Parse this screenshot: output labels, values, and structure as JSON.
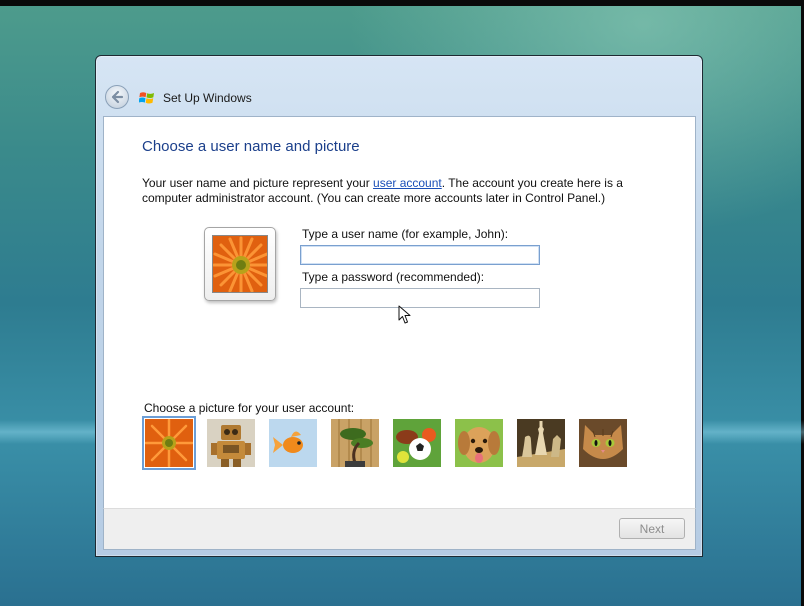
{
  "window": {
    "title": "Set Up Windows"
  },
  "page": {
    "heading": "Choose a user name and picture",
    "description_before": "Your user name and picture represent your ",
    "description_link": "user account",
    "description_after": ". The account you create here is a computer administrator account. (You can create more accounts later in Control Panel.)"
  },
  "form": {
    "username_label": "Type a user name (for example, John):",
    "username_value": "",
    "password_label": "Type a password (recommended):",
    "password_value": ""
  },
  "pictures": {
    "label": "Choose a picture for your user account:",
    "items": [
      {
        "icon": "orange-flower",
        "selected": true
      },
      {
        "icon": "robot-toy"
      },
      {
        "icon": "goldfish"
      },
      {
        "icon": "bonsai-tree"
      },
      {
        "icon": "sports-balls"
      },
      {
        "icon": "puppy-dog"
      },
      {
        "icon": "chess-pieces"
      },
      {
        "icon": "kitten"
      }
    ]
  },
  "footer": {
    "next_label": "Next"
  },
  "colors": {
    "accent": "#1b3f8b",
    "link": "#1a4fb8",
    "selection": "#6c9ed6"
  }
}
